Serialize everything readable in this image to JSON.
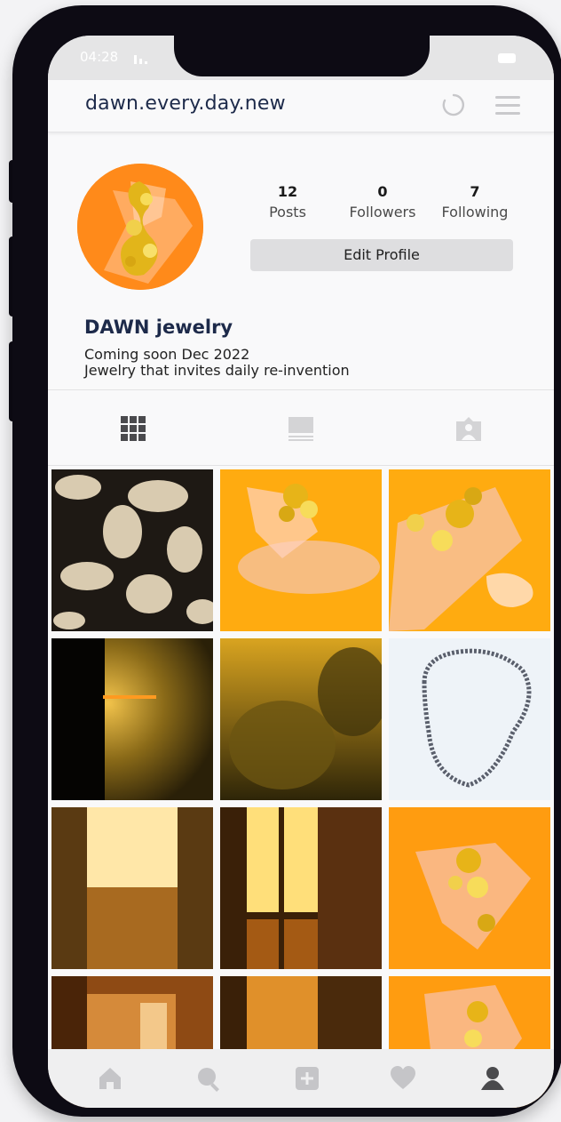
{
  "status_bar": {
    "time": "04:28"
  },
  "header": {
    "username": "dawn.every.day.new"
  },
  "profile": {
    "display_name": "DAWN jewelry",
    "bio_line1": "Coming soon Dec 2022",
    "bio_line2": "Jewelry that invites daily re-invention",
    "edit_button": "Edit Profile",
    "stats": [
      {
        "value": "12",
        "label": "Posts"
      },
      {
        "value": "0",
        "label": "Followers"
      },
      {
        "value": "7",
        "label": "Following"
      }
    ]
  },
  "tabs": [
    "grid-icon",
    "feed-icon",
    "tagged-icon"
  ],
  "nav": [
    "home-icon",
    "search-icon",
    "add-post-icon",
    "heart-icon",
    "profile-icon"
  ],
  "colors": {
    "accent": "#ff8a1a",
    "amber": "#ffae00",
    "text_dark": "#1d2a4a"
  }
}
